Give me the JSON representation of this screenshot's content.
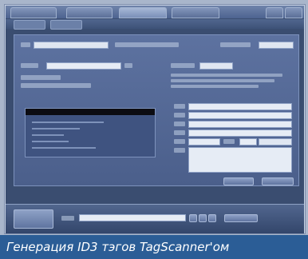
{
  "caption": "Генерация ID3 тэгов TagScanner'ом"
}
